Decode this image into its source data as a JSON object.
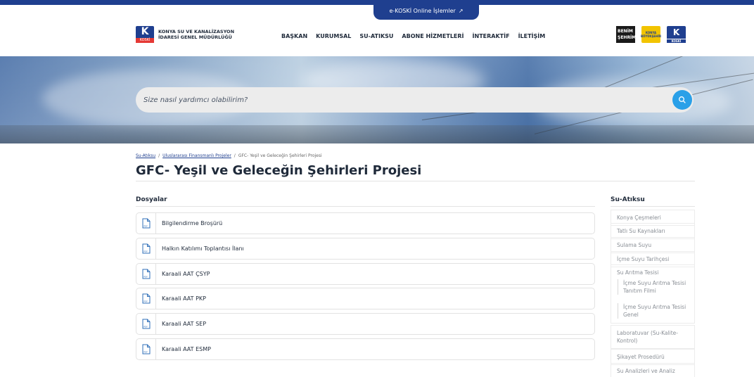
{
  "top": {
    "eko_label": "e-KOSKİ Online İşlemler",
    "eko_arrow": "↗"
  },
  "header": {
    "logo_k": "K",
    "logo_sub": "KOSKİ",
    "logo_line1": "KONYA SU VE KANALİZASYON",
    "logo_line2": "İDARESİ GENEL MÜDÜRLÜĞÜ",
    "nav": [
      "BAŞKAN",
      "KURUMSAL",
      "SU-ATIKSU",
      "ABONE HİZMETLERİ",
      "İNTERAKTİF",
      "İLETİŞİM"
    ],
    "partner_benim_1": "BENİM",
    "partner_benim_2": "ŞEHRİM",
    "partner_bsb_1": "KONYA",
    "partner_bsb_2": "BÜYÜKŞEHİR",
    "partner_koski_k": "K",
    "partner_koski_sub": "KOSKİ"
  },
  "search": {
    "placeholder": "Size nasıl yardımcı olabilirim?",
    "icon": "search-icon"
  },
  "breadcrumb": {
    "items": [
      "Su-Atıksu",
      "Uluslararası Finansmanlı Projeler",
      "GFC- Yeşil ve Geleceğin Şehirleri Projesi"
    ],
    "separator": "/"
  },
  "page": {
    "title": "GFC- Yeşil ve Geleceğin Şehirleri Projesi"
  },
  "files": {
    "heading": "Dosyalar",
    "icon_label": "PDF",
    "items": [
      "Bilgilendirme Broşürü",
      "Halkın Katılımı Toplantısı İlanı",
      "Karaali AAT ÇSYP",
      "Karaali AAT PKP",
      "Karaali AAT SEP",
      "Karaali AAT ESMP"
    ]
  },
  "sidebar": {
    "heading": "Su-Atıksu",
    "items": [
      "Konya Çeşmeleri",
      "Tatlı Su Kaynakları",
      "Sulama Suyu",
      "İçme Suyu Tarihçesi",
      "Su Arıtma Tesisi",
      "Laboratuvar (Su-Kalite-Kontrol)",
      "Şikayet Prosedürü",
      "Su Analizleri ve Analiz"
    ],
    "sub_items": [
      "İçme Suyu Arıtma Tesisi Tanıtım Filmi",
      "İçme Suyu Arıtma Tesisi Genel"
    ]
  }
}
